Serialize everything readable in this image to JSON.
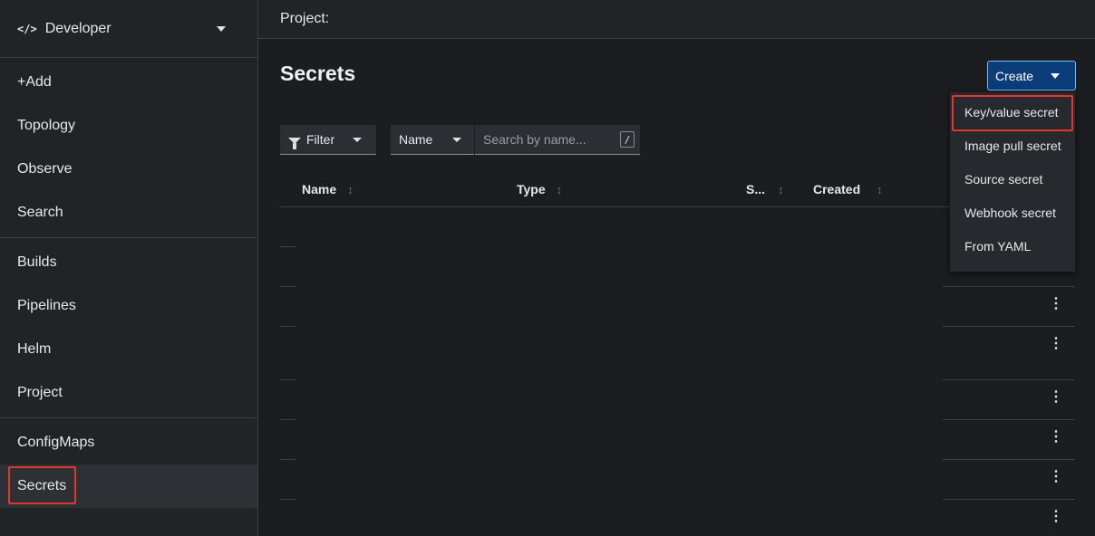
{
  "perspective": {
    "label": "Developer"
  },
  "sidebar": {
    "groups": [
      [
        {
          "label": "+Add"
        },
        {
          "label": "Topology"
        },
        {
          "label": "Observe"
        },
        {
          "label": "Search"
        }
      ],
      [
        {
          "label": "Builds"
        },
        {
          "label": "Pipelines"
        },
        {
          "label": "Helm"
        },
        {
          "label": "Project"
        }
      ],
      [
        {
          "label": "ConfigMaps"
        },
        {
          "label": "Secrets"
        }
      ]
    ]
  },
  "topbar": {
    "project_label": "Project:"
  },
  "page": {
    "title": "Secrets"
  },
  "create": {
    "label": "Create",
    "menu": [
      {
        "label": "Key/value secret"
      },
      {
        "label": "Image pull secret"
      },
      {
        "label": "Source secret"
      },
      {
        "label": "Webhook secret"
      },
      {
        "label": "From YAML"
      }
    ]
  },
  "filter": {
    "filter_label": "Filter",
    "name_select": "Name",
    "search_placeholder": "Search by name...",
    "shortcut": "/"
  },
  "table": {
    "columns": [
      "Name",
      "Type",
      "S...",
      "Created"
    ]
  }
}
